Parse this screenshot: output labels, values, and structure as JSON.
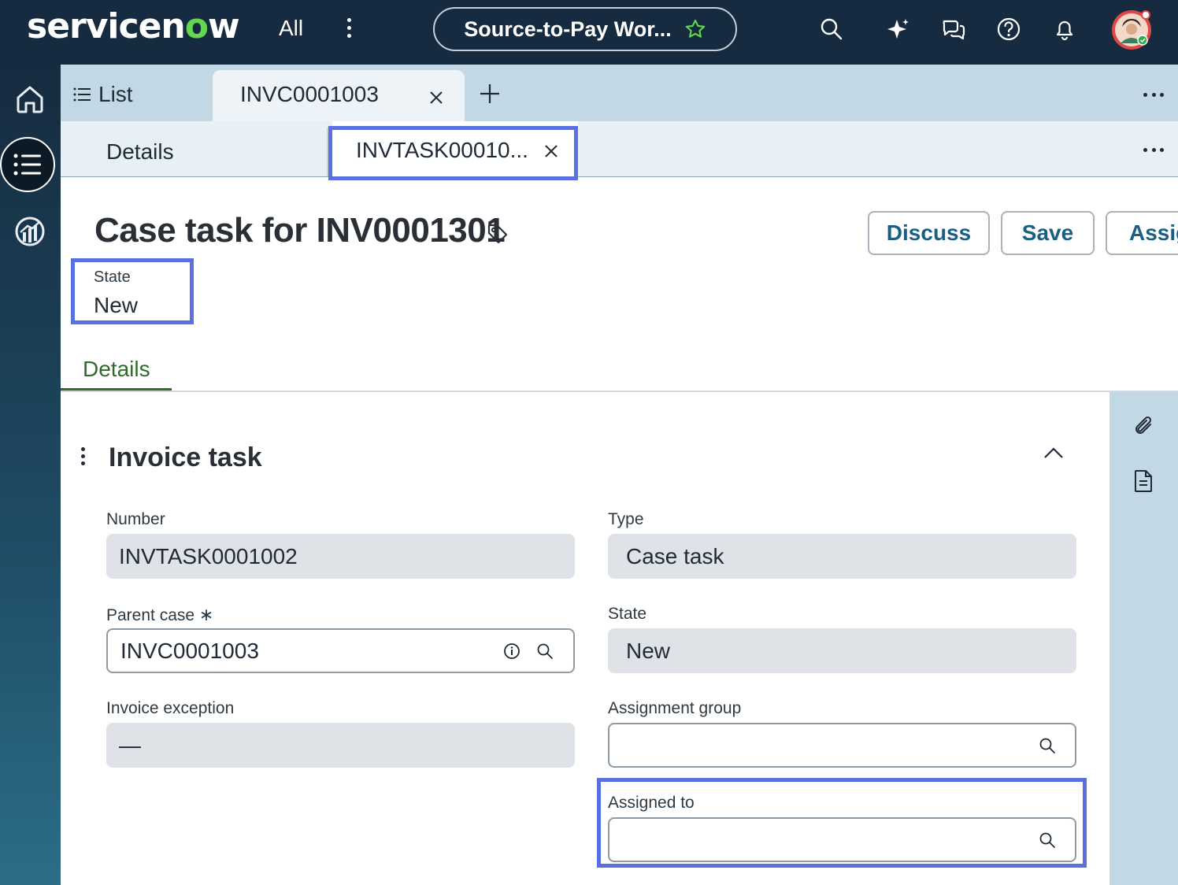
{
  "topbar": {
    "logo_prefix": "servicen",
    "logo_o": "o",
    "logo_suffix": "w",
    "all_label": "All",
    "workspace_label": "Source-to-Pay Wor...",
    "icons": [
      "search-icon",
      "sparkle-icon",
      "chat-icon",
      "help-icon",
      "bell-icon",
      "avatar"
    ]
  },
  "rail": {
    "icons": [
      "home-icon",
      "list-icon",
      "analytics-icon"
    ]
  },
  "tabs_primary": {
    "list_label": "List",
    "record_tab_label": "INVC0001003"
  },
  "tabs_secondary": {
    "details_label": "Details",
    "task_tab_label": "INVTASK00010..."
  },
  "header": {
    "title": "Case task for INV0001301",
    "buttons": {
      "discuss": "Discuss",
      "save": "Save",
      "assign": "Assig"
    },
    "state_label": "State",
    "state_value": "New"
  },
  "form_tab": "Details",
  "section": {
    "title": "Invoice task",
    "fields": {
      "number": {
        "label": "Number",
        "value": "INVTASK0001002"
      },
      "type": {
        "label": "Type",
        "value": "Case task"
      },
      "parent_case": {
        "label": "Parent case",
        "required_mark": "∗",
        "value": "INVC0001003"
      },
      "state": {
        "label": "State",
        "value": "New"
      },
      "invoice_exception": {
        "label": "Invoice exception",
        "value": "—"
      },
      "assignment_group": {
        "label": "Assignment group",
        "value": ""
      },
      "assigned_to": {
        "label": "Assigned to",
        "value": ""
      }
    }
  },
  "colors": {
    "topbar": "#162b3f",
    "accent": "#1b5e84",
    "highlight": "#5a70e0",
    "tab_active": "#2f6b2b",
    "logo_o": "#62d84e"
  }
}
